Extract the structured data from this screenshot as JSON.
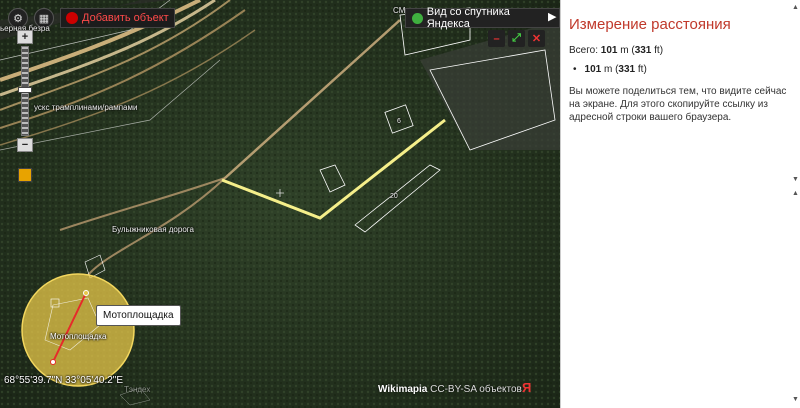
{
  "map": {
    "add_object_label": "Добавить объект",
    "satellite_button_label": "Вид со спутника Яндекса",
    "satellite_header_clip": "СМ",
    "road_label_ramps": "ускс трамплинами/рампами",
    "road_label_bulyzhnikovaya": "Булыжниковая дорога",
    "top_left_clip": "ьерная безра",
    "tooltip": "Мотоплощадка",
    "circle_label": "Мотоплощадка",
    "building_label_1": "6",
    "building_label_2": "20",
    "coordinates": "68°55'39.7\"N 33°05'40.2\"E",
    "attribution_brand": "Wikimapia",
    "attribution_license": "CC-BY-SA",
    "attribution_suffix": "объектов",
    "yandex_logo": "Я",
    "bottom_left_clip": "Тэндех"
  },
  "controls": {
    "zoom_in": "+",
    "zoom_out": "−",
    "minimize": "–",
    "fullscreen": "⤢",
    "close": "✕",
    "sat_arrow": "▶"
  },
  "panel": {
    "title": "Измерение расстояния",
    "total_prefix": "Всего: ",
    "total_m": "101",
    "unit_m": " m (",
    "total_ft": "331",
    "unit_ft": " ft)",
    "segment_m": "101",
    "segment_ft": "331",
    "note": "Вы можете поделиться тем, что видите сейчас на экране. Для этого скопируйте ссылку из адресной строки вашего браузера."
  }
}
